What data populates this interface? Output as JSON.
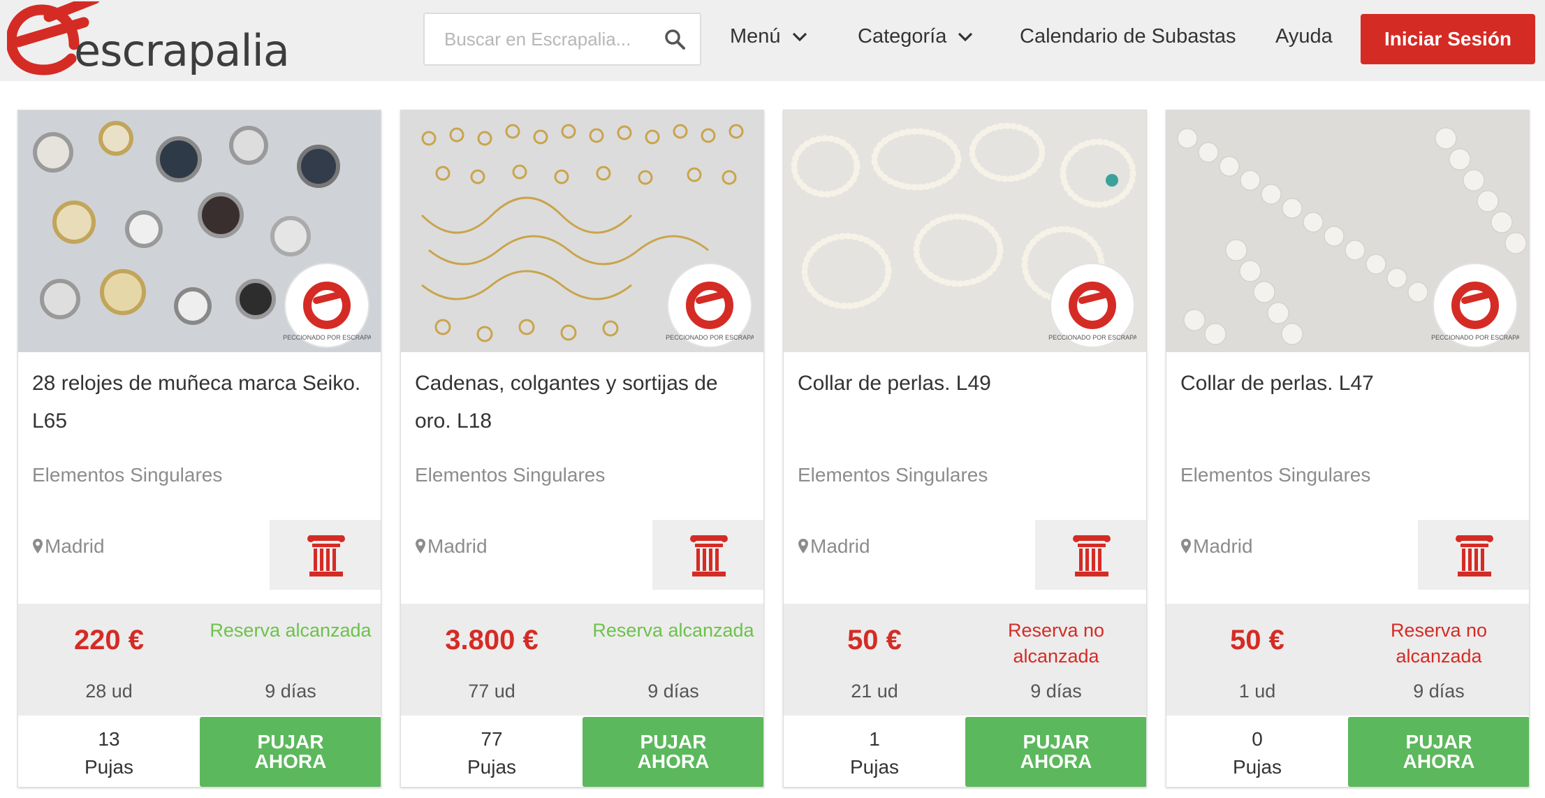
{
  "header": {
    "logo_text": "escrapalia",
    "search_placeholder": "Buscar en Escrapalia...",
    "nav": {
      "menu": "Menú",
      "category": "Categoría",
      "calendar": "Calendario de Subastas",
      "help": "Ayuda"
    },
    "login_label": "Iniciar Sesión"
  },
  "badge_text": "INSPECCIONADO POR ESCRAPALIA",
  "colors": {
    "brand_red": "#d52b25",
    "green": "#5cb85c",
    "reserve_ok": "#6cc24a"
  },
  "cards": [
    {
      "title": "28 relojes de muñeca marca Seiko. L65",
      "seller": "Elementos Singulares",
      "location": "Madrid",
      "price": "220 €",
      "reserve": "Reserva alcanzada",
      "reserve_status": "alcanzada",
      "units": "28 ud",
      "days": "9 días",
      "bid_count": "13",
      "bid_label": "Pujas",
      "cta_line1": "PUJAR",
      "cta_line2": "AHORA"
    },
    {
      "title": "Cadenas, colgantes y sortijas de oro. L18",
      "seller": "Elementos Singulares",
      "location": "Madrid",
      "price": "3.800 €",
      "reserve": "Reserva alcanzada",
      "reserve_status": "alcanzada",
      "units": "77 ud",
      "days": "9 días",
      "bid_count": "77",
      "bid_label": "Pujas",
      "cta_line1": "PUJAR",
      "cta_line2": "AHORA"
    },
    {
      "title": "Collar de perlas. L49",
      "seller": "Elementos Singulares",
      "location": "Madrid",
      "price": "50 €",
      "reserve": "Reserva no alcanzada",
      "reserve_status": "no alcanzada",
      "units": "21 ud",
      "days": "9 días",
      "bid_count": "1",
      "bid_label": "Pujas",
      "cta_line1": "PUJAR",
      "cta_line2": "AHORA"
    },
    {
      "title": "Collar de perlas. L47",
      "seller": "Elementos Singulares",
      "location": "Madrid",
      "price": "50 €",
      "reserve": "Reserva no alcanzada",
      "reserve_status": "no alcanzada",
      "units": "1 ud",
      "days": "9 días",
      "bid_count": "0",
      "bid_label": "Pujas",
      "cta_line1": "PUJAR",
      "cta_line2": "AHORA"
    }
  ]
}
